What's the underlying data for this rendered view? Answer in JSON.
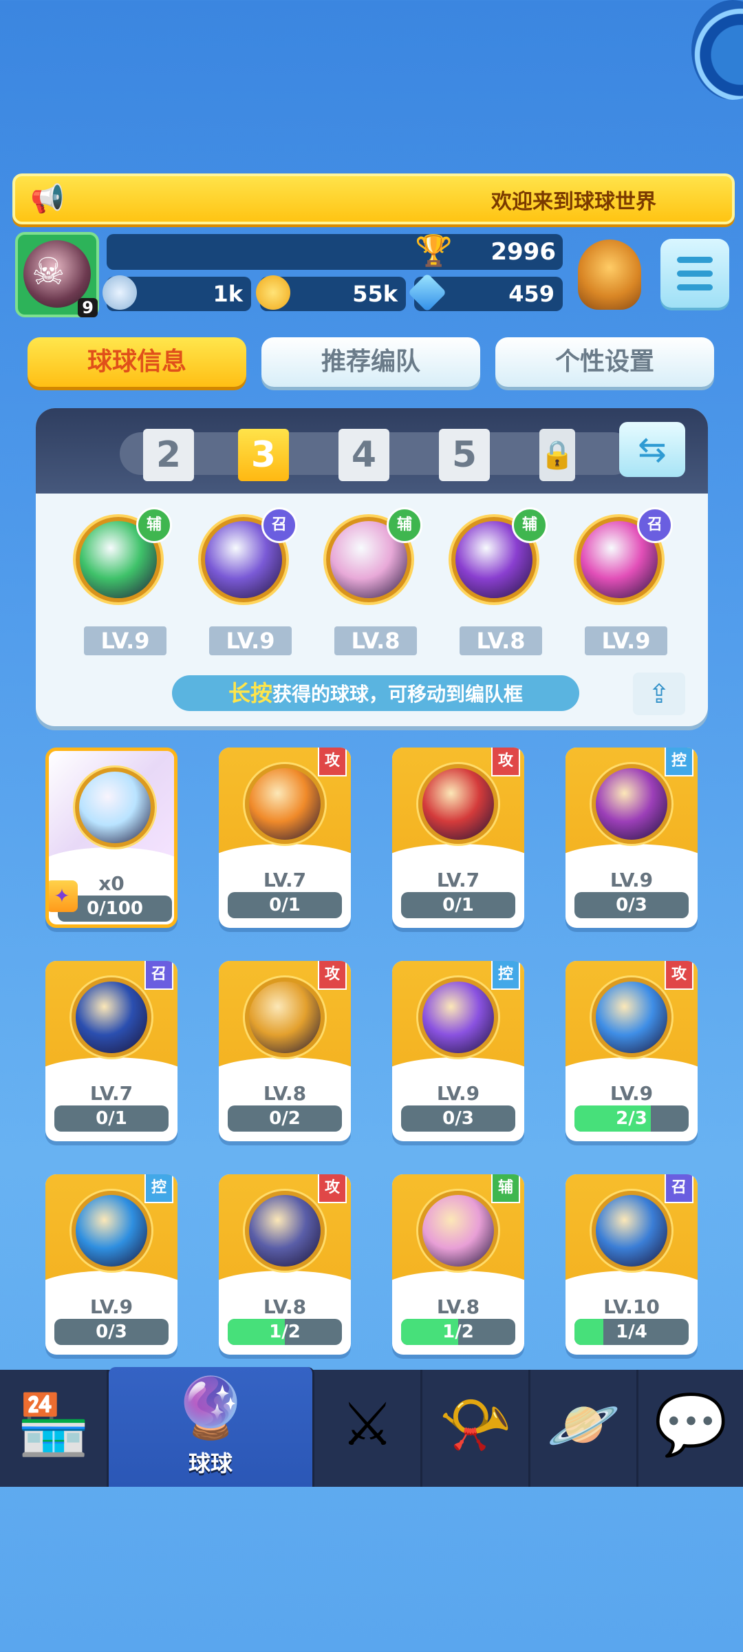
{
  "announcement": {
    "icon": "megaphone-icon",
    "text": "欢迎来到球球世界"
  },
  "player": {
    "avatar_icon": "skull-icon",
    "level": "9",
    "trophies": "2996",
    "rank_icon": "rank-medal-icon"
  },
  "currencies": [
    {
      "icon": "star-coin-icon",
      "value": "1k"
    },
    {
      "icon": "clover-coin-icon",
      "value": "55k"
    },
    {
      "icon": "diamond-icon",
      "value": "459"
    }
  ],
  "tabs": [
    {
      "label": "球球信息",
      "active": true
    },
    {
      "label": "推荐编队",
      "active": false
    },
    {
      "label": "个性设置",
      "active": false
    }
  ],
  "team": {
    "slots": [
      "2",
      "3",
      "4",
      "5"
    ],
    "selected": "3",
    "balls": [
      {
        "tag": "辅",
        "level": "LV.9",
        "color": "#3fc26a"
      },
      {
        "tag": "召",
        "level": "LV.9",
        "color": "#7a5ad6"
      },
      {
        "tag": "辅",
        "level": "LV.8",
        "color": "#e8a9d8"
      },
      {
        "tag": "辅",
        "level": "LV.8",
        "color": "#8a3fd0"
      },
      {
        "tag": "召",
        "level": "LV.9",
        "color": "#e24fb8"
      }
    ],
    "hint_highlight": "长按",
    "hint_text": "获得的球球，可移动到编队框"
  },
  "cards": [
    {
      "tag": "",
      "level": "x0",
      "progress": "0/100",
      "fraction": 0,
      "color": "#b9e3ff",
      "special": true
    },
    {
      "tag": "攻",
      "level": "LV.7",
      "progress": "0/1",
      "fraction": 0,
      "color": "#f08a2a"
    },
    {
      "tag": "攻",
      "level": "LV.7",
      "progress": "0/1",
      "fraction": 0,
      "color": "#d43b3b"
    },
    {
      "tag": "控",
      "level": "LV.9",
      "progress": "0/3",
      "fraction": 0,
      "color": "#9c3fb8"
    },
    {
      "tag": "召",
      "level": "LV.7",
      "progress": "0/1",
      "fraction": 0,
      "color": "#2b4fb0"
    },
    {
      "tag": "攻",
      "level": "LV.8",
      "progress": "0/2",
      "fraction": 0,
      "color": "#e3a02e"
    },
    {
      "tag": "控",
      "level": "LV.9",
      "progress": "0/3",
      "fraction": 0,
      "color": "#8a52e0"
    },
    {
      "tag": "攻",
      "level": "LV.9",
      "progress": "2/3",
      "fraction": 0.667,
      "color": "#3f8ee6"
    },
    {
      "tag": "控",
      "level": "LV.9",
      "progress": "0/3",
      "fraction": 0,
      "color": "#2f8fe0"
    },
    {
      "tag": "攻",
      "level": "LV.8",
      "progress": "1/2",
      "fraction": 0.5,
      "color": "#5a5ea8"
    },
    {
      "tag": "辅",
      "level": "LV.8",
      "progress": "1/2",
      "fraction": 0.5,
      "color": "#e89fd6"
    },
    {
      "tag": "召",
      "level": "LV.10",
      "progress": "1/4",
      "fraction": 0.25,
      "color": "#3b7ed6"
    }
  ],
  "nav": [
    {
      "icon": "shop-icon",
      "label": ""
    },
    {
      "icon": "ball-icon",
      "label": "球球",
      "active": true
    },
    {
      "icon": "crossed-swords-icon",
      "label": ""
    },
    {
      "icon": "whistle-icon",
      "label": ""
    },
    {
      "icon": "planet-icon",
      "label": ""
    },
    {
      "icon": "chat-heart-icon",
      "label": ""
    }
  ]
}
